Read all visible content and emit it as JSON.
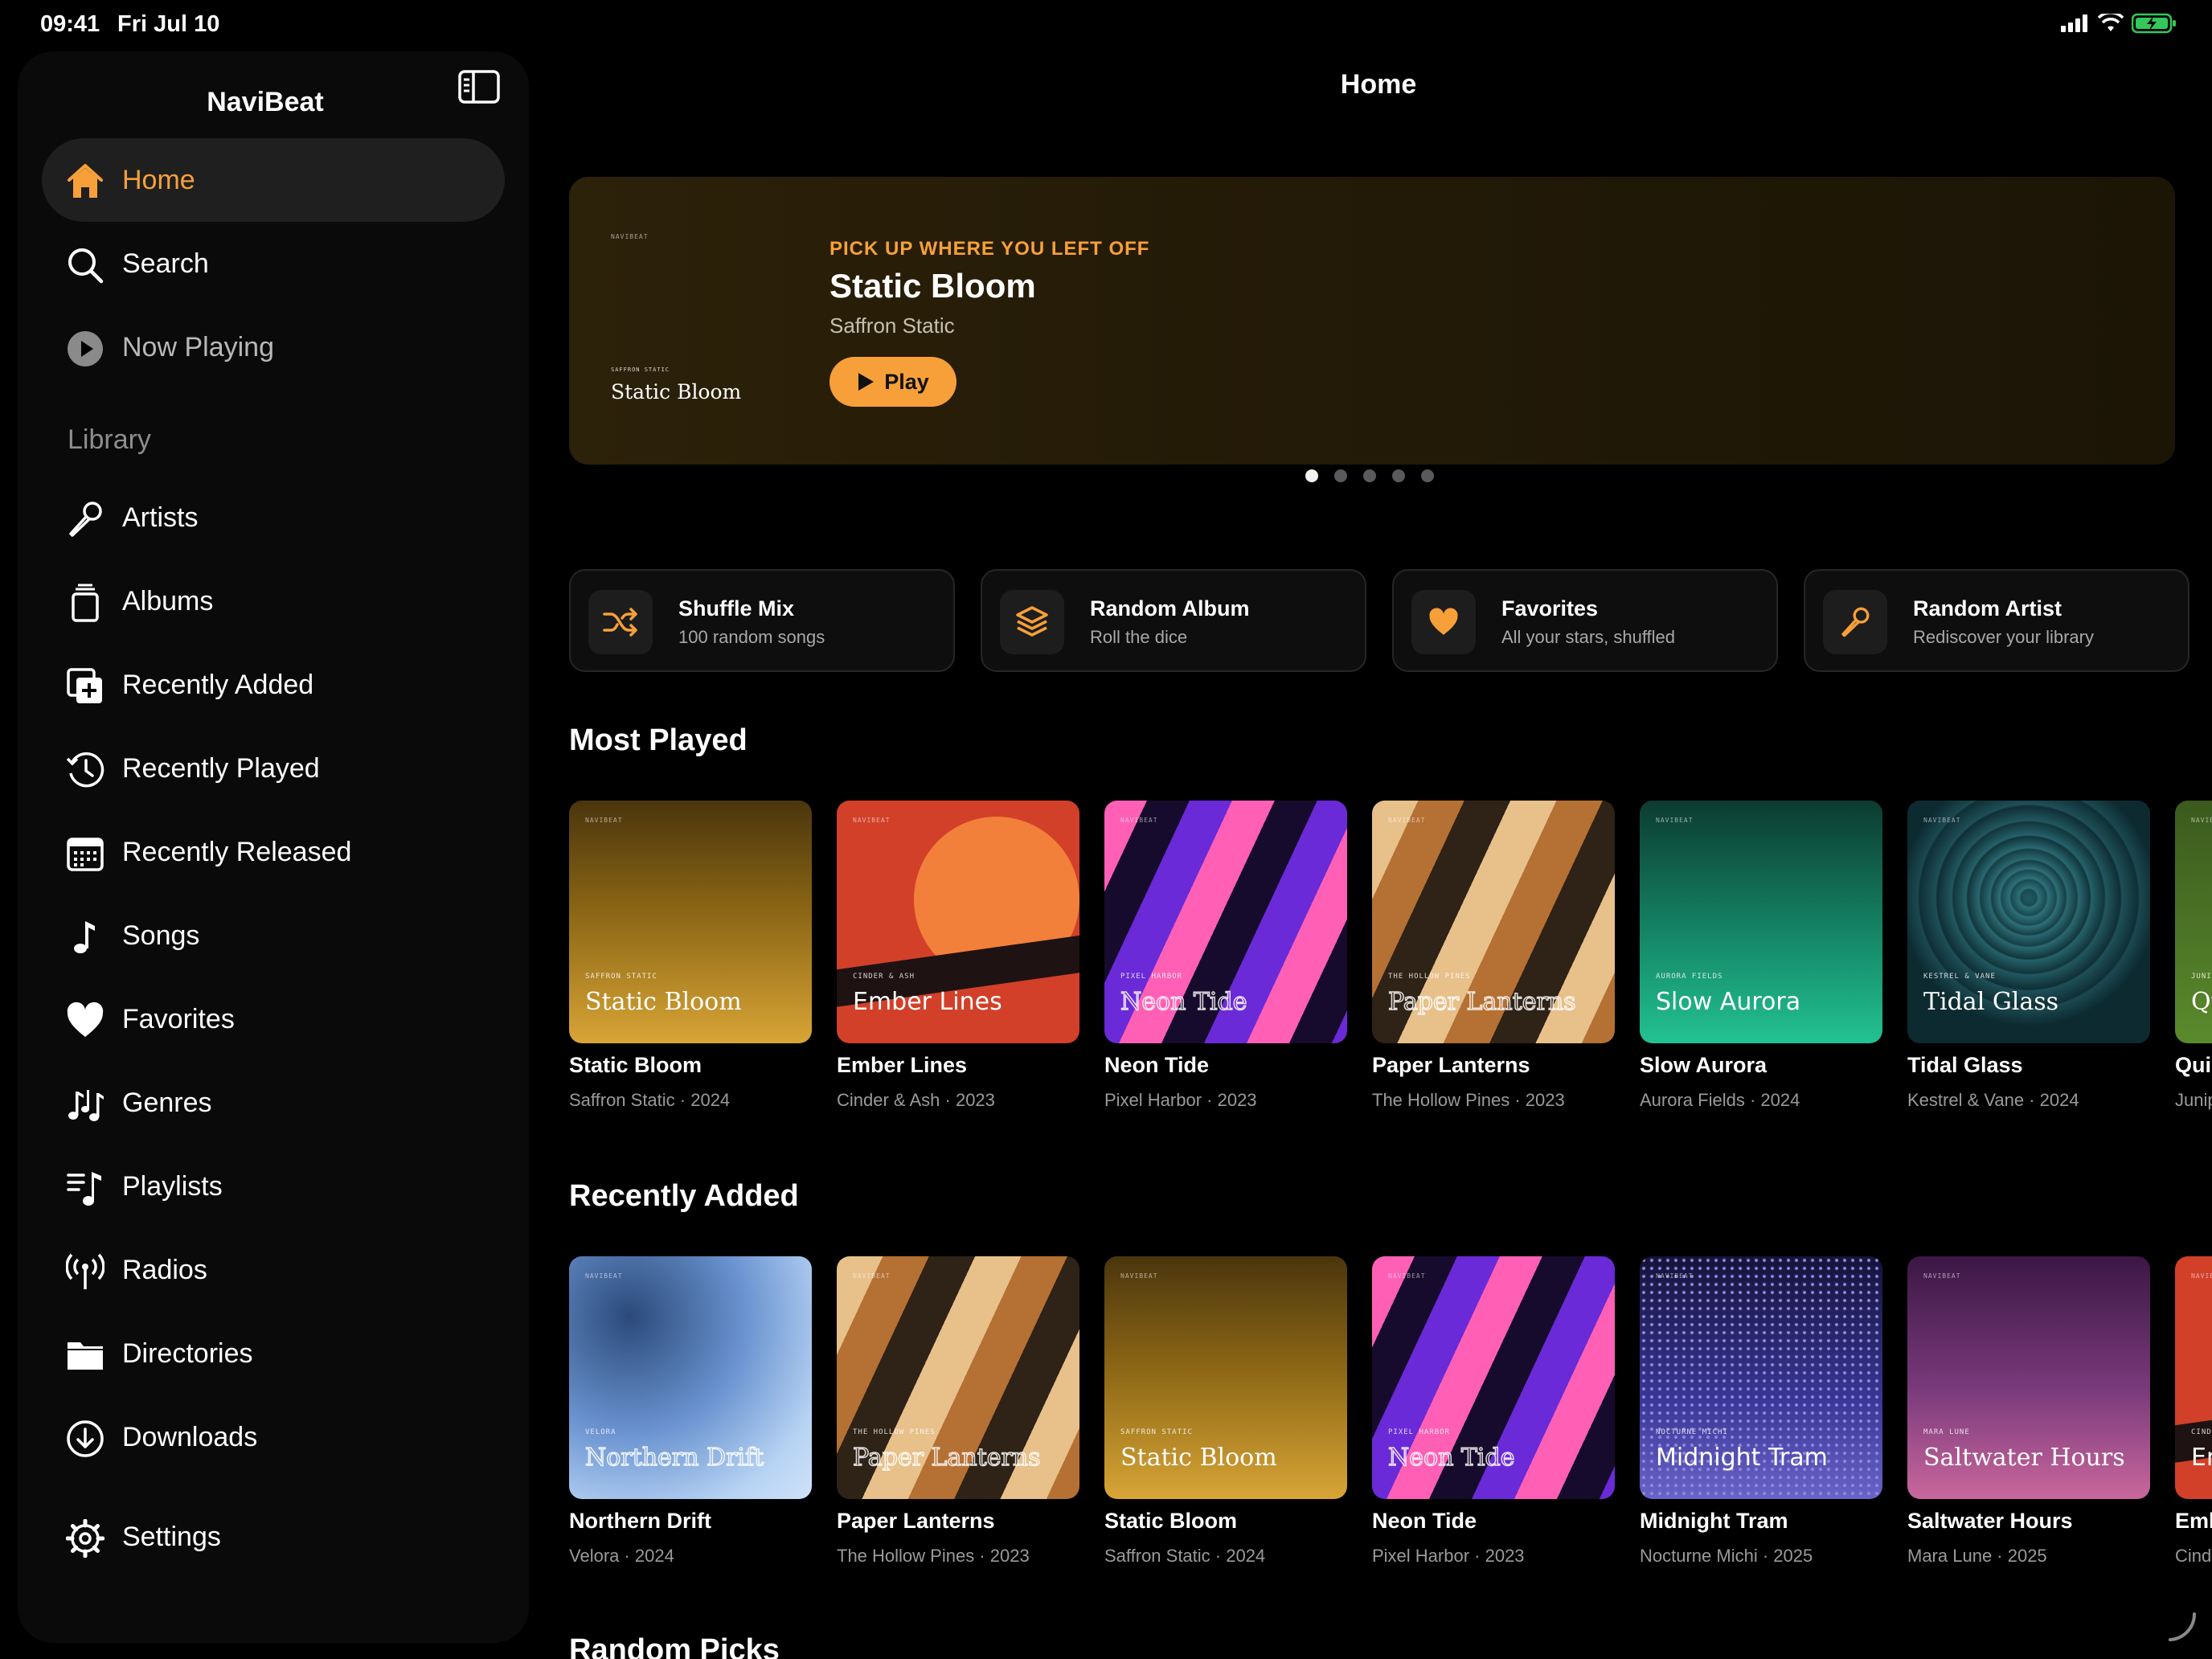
{
  "status_bar": {
    "time": "09:41",
    "date": "Fri Jul 10"
  },
  "app_name": "NaviBeat",
  "page_title": "Home",
  "sidebar": {
    "nav": [
      {
        "label": "Home",
        "icon": "house-icon"
      },
      {
        "label": "Search",
        "icon": "magnifier-icon"
      },
      {
        "label": "Now Playing",
        "icon": "play-circle-icon"
      }
    ],
    "library_heading": "Library",
    "library": [
      {
        "label": "Artists",
        "icon": "microphone-icon"
      },
      {
        "label": "Albums",
        "icon": "album-stack-icon"
      },
      {
        "label": "Recently Added",
        "icon": "add-media-icon"
      },
      {
        "label": "Recently Played",
        "icon": "history-clock-icon"
      },
      {
        "label": "Recently Released",
        "icon": "calendar-icon"
      },
      {
        "label": "Songs",
        "icon": "music-note-icon"
      },
      {
        "label": "Favorites",
        "icon": "heart-icon"
      },
      {
        "label": "Genres",
        "icon": "music-notes-icon"
      },
      {
        "label": "Playlists",
        "icon": "playlist-icon"
      },
      {
        "label": "Radios",
        "icon": "antenna-icon"
      },
      {
        "label": "Directories",
        "icon": "folder-icon"
      },
      {
        "label": "Downloads",
        "icon": "download-circle-icon"
      }
    ],
    "settings": {
      "label": "Settings",
      "icon": "gear-icon"
    }
  },
  "hero": {
    "eyebrow": "PICK UP WHERE YOU LEFT OFF",
    "title": "Static Bloom",
    "artist": "Saffron Static",
    "play_label": "Play",
    "cover_small": "NAVIBEAT",
    "cover_tag": "SAFFRON STATIC",
    "cover_title": "Static Bloom",
    "page_index": 1,
    "page_count": 5
  },
  "quick_actions": [
    {
      "title": "Shuffle Mix",
      "subtitle": "100 random songs",
      "icon": "shuffle-icon"
    },
    {
      "title": "Random Album",
      "subtitle": "Roll the dice",
      "icon": "layers-icon"
    },
    {
      "title": "Favorites",
      "subtitle": "All your stars, shuffled",
      "icon": "heart-icon"
    },
    {
      "title": "Random Artist",
      "subtitle": "Rediscover your library",
      "icon": "microphone-icon"
    }
  ],
  "most_played": {
    "heading": "Most Played",
    "items": [
      {
        "title": "Static Bloom",
        "subtitle": "Saffron Static · 2024",
        "cover_tag": "SAFFRON STATIC",
        "cover_title": "Static Bloom",
        "style": "static-bloom"
      },
      {
        "title": "Ember Lines",
        "subtitle": "Cinder & Ash · 2023",
        "cover_tag": "CINDER & ASH",
        "cover_title": "Ember Lines",
        "style": "ember-lines"
      },
      {
        "title": "Neon Tide",
        "subtitle": "Pixel Harbor · 2023",
        "cover_tag": "PIXEL HARBOR",
        "cover_title": "Neon Tide",
        "style": "neon-tide"
      },
      {
        "title": "Paper Lanterns",
        "subtitle": "The Hollow Pines · 2023",
        "cover_tag": "THE HOLLOW PINES",
        "cover_title": "Paper Lanterns",
        "style": "paper-lanterns"
      },
      {
        "title": "Slow Aurora",
        "subtitle": "Aurora Fields · 2024",
        "cover_tag": "AURORA FIELDS",
        "cover_title": "Slow Aurora",
        "style": "slow-aurora"
      },
      {
        "title": "Tidal Glass",
        "subtitle": "Kestrel & Vane · 2024",
        "cover_tag": "KESTREL & VANE",
        "cover_title": "Tidal Glass",
        "style": "tidal-glass"
      },
      {
        "title": "Quie",
        "subtitle": "Junip",
        "cover_tag": "JUNIP",
        "cover_title": "Qu",
        "style": "quiet-green"
      }
    ]
  },
  "recently_added": {
    "heading": "Recently Added",
    "items": [
      {
        "title": "Northern Drift",
        "subtitle": "Velora · 2024",
        "cover_tag": "VELORA",
        "cover_title": "Northern Drift",
        "style": "northern-drift"
      },
      {
        "title": "Paper Lanterns",
        "subtitle": "The Hollow Pines · 2023",
        "cover_tag": "THE HOLLOW PINES",
        "cover_title": "Paper Lanterns",
        "style": "paper-lanterns"
      },
      {
        "title": "Static Bloom",
        "subtitle": "Saffron Static · 2024",
        "cover_tag": "SAFFRON STATIC",
        "cover_title": "Static Bloom",
        "style": "static-bloom"
      },
      {
        "title": "Neon Tide",
        "subtitle": "Pixel Harbor · 2023",
        "cover_tag": "PIXEL HARBOR",
        "cover_title": "Neon Tide",
        "style": "neon-tide"
      },
      {
        "title": "Midnight Tram",
        "subtitle": "Nocturne Michi · 2025",
        "cover_tag": "NOCTURNE MICHI",
        "cover_title": "Midnight Tram",
        "style": "midnight-tram"
      },
      {
        "title": "Saltwater Hours",
        "subtitle": "Mara Lune · 2025",
        "cover_tag": "MARA LUNE",
        "cover_title": "Saltwater Hours",
        "style": "saltwater-hours"
      },
      {
        "title": "Emb",
        "subtitle": "Cinde",
        "cover_tag": "CINDER",
        "cover_title": "Em",
        "style": "ember-lines"
      }
    ]
  },
  "random_picks": {
    "heading": "Random Picks"
  },
  "colors": {
    "accent": "#f7a03a",
    "background": "#000000",
    "sidebar": "#0a0a0a"
  }
}
